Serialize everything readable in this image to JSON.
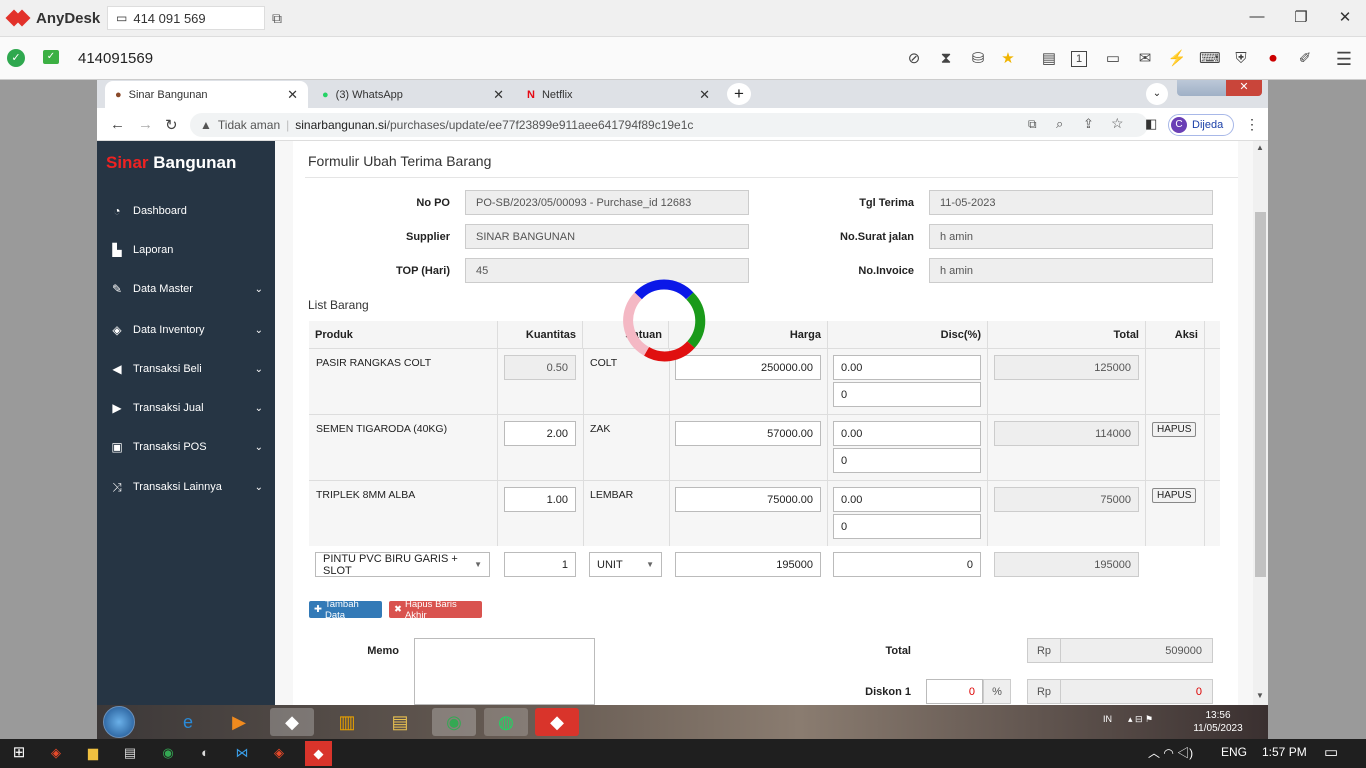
{
  "anydesk": {
    "app_name": "AnyDesk",
    "address": "414 091 569",
    "session_id": "414091569"
  },
  "browser": {
    "tabs": [
      {
        "label": "Sinar Bangunan"
      },
      {
        "label": "(3) WhatsApp"
      },
      {
        "label": "Netflix"
      }
    ],
    "security": "Tidak aman",
    "url_host": "sinarbangunan.si",
    "url_path": "/purchases/update/ee77f23899e911aee641794f89c19e1c",
    "profile_label": "Dijeda",
    "profile_initial": "C"
  },
  "sidebar": {
    "brand_red": "Sinar",
    "brand_white": " Bangunan",
    "items": [
      {
        "label": "Dashboard",
        "icon": "dashboard-icon",
        "glyph": "◔"
      },
      {
        "label": "Laporan",
        "icon": "chart-icon",
        "glyph": "▙"
      },
      {
        "label": "Data Master",
        "icon": "edit-icon",
        "glyph": "✎"
      },
      {
        "label": "Data Inventory",
        "icon": "cube-icon",
        "glyph": "◈"
      },
      {
        "label": "Transaksi Beli",
        "icon": "arrow-left-circle-icon",
        "glyph": "◀"
      },
      {
        "label": "Transaksi Jual",
        "icon": "arrow-right-circle-icon",
        "glyph": "▶"
      },
      {
        "label": "Transaksi POS",
        "icon": "money-icon",
        "glyph": "▣"
      },
      {
        "label": "Transaksi Lainnya",
        "icon": "shuffle-icon",
        "glyph": "⤨"
      }
    ]
  },
  "form": {
    "title": "Formulir Ubah Terima Barang",
    "no_po_label": "No PO",
    "no_po": "PO-SB/2023/05/00093 -  Purchase_id 12683",
    "supplier_label": "Supplier",
    "supplier": "SINAR BANGUNAN",
    "top_label": "TOP (Hari)",
    "top": "45",
    "tgl_label": "Tgl Terima",
    "tgl": "11-05-2023",
    "surat_label": "No.Surat jalan",
    "surat": "h amin",
    "invoice_label": "No.Invoice",
    "invoice": "h amin"
  },
  "list": {
    "title": "List Barang",
    "headers": [
      "Produk",
      "Kuantitas",
      "Satuan",
      "Harga",
      "Disc(%)",
      "Total",
      "Aksi"
    ],
    "rows": [
      {
        "produk": "PASIR RANGKAS COLT",
        "qty": "0.50",
        "satuan": "COLT",
        "harga": "250000.00",
        "disc1": "0.00",
        "disc2": "0",
        "total": "125000",
        "aksi": ""
      },
      {
        "produk": "SEMEN TIGARODA (40KG)",
        "qty": "2.00",
        "satuan": "ZAK",
        "harga": "57000.00",
        "disc1": "0.00",
        "disc2": "0",
        "total": "114000",
        "aksi": "HAPUS"
      },
      {
        "produk": "TRIPLEK 8MM ALBA",
        "qty": "1.00",
        "satuan": "LEMBAR",
        "harga": "75000.00",
        "disc1": "0.00",
        "disc2": "0",
        "total": "75000",
        "aksi": "HAPUS"
      }
    ],
    "new_row": {
      "produk": "PINTU PVC BIRU GARIS + SLOT",
      "qty": "1",
      "satuan": "UNIT",
      "harga": "195000",
      "disc": "0",
      "total": "195000"
    },
    "add_button": "Tambah Data",
    "remove_button": "Hapus Baris Akhir"
  },
  "summary": {
    "memo_label": "Memo",
    "total_label": "Total",
    "currency": "Rp",
    "total": "509000",
    "diskon_label": "Diskon 1",
    "diskon_pct": "0",
    "pct_sign": "%",
    "diskon_value": "0"
  },
  "w7_taskbar": {
    "lang": "IN",
    "time": "13:56",
    "date": "11/05/2023"
  },
  "w10_taskbar": {
    "lang": "ENG",
    "time": "1:57 PM"
  },
  "colors": {
    "sidebar_bg": "#263544",
    "brand_red": "#e22222",
    "btn_primary": "#337ab7",
    "btn_danger": "#d9534f",
    "anydesk_red": "#e2312a"
  }
}
